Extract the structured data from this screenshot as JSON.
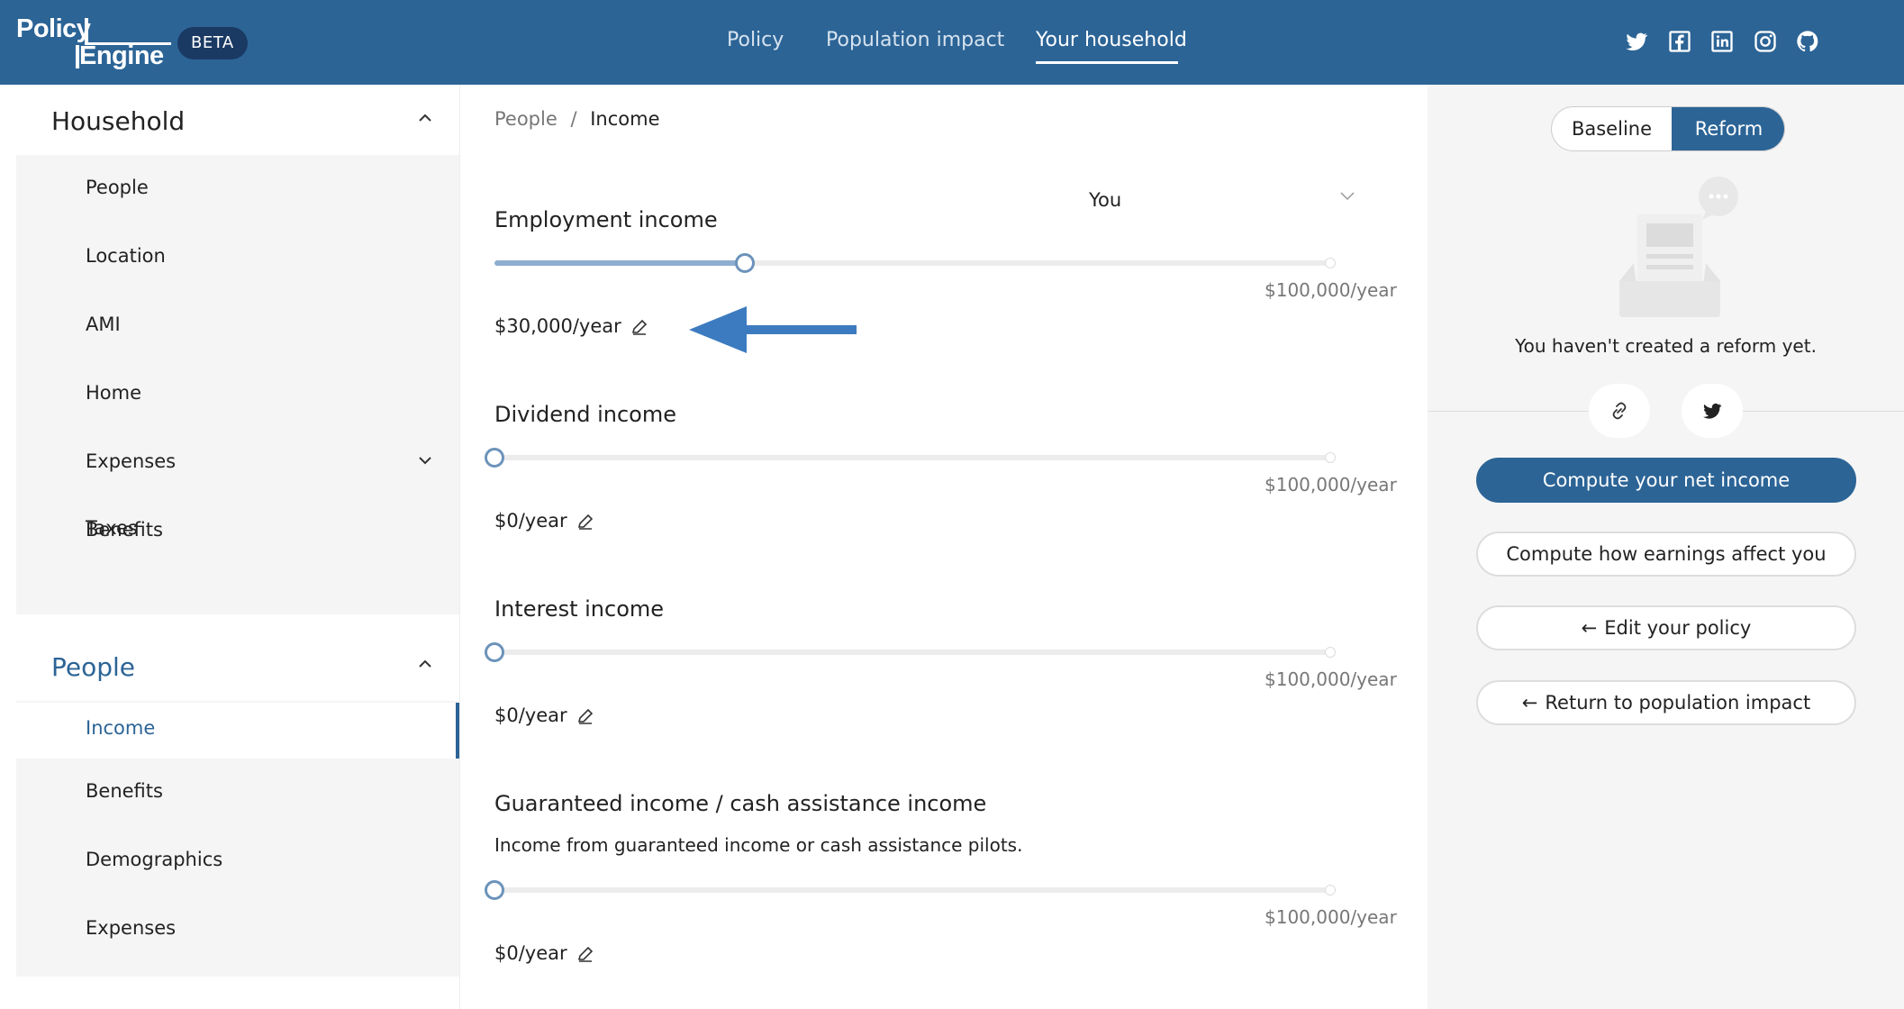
{
  "header": {
    "logo_line1": "Policy",
    "logo_line2": "Engine",
    "beta": "BETA",
    "nav": [
      "Policy",
      "Population impact",
      "Your household"
    ],
    "active_nav": "Your household",
    "social_icons": [
      "twitter-icon",
      "facebook-icon",
      "linkedin-icon",
      "instagram-icon",
      "github-icon"
    ],
    "colors": {
      "brand": "#2c6496",
      "beta_bg": "#1a3a63"
    }
  },
  "sidebar": {
    "household": {
      "title": "Household",
      "items": [
        "People",
        "Location",
        "AMI",
        "Home",
        "Expenses",
        "Benefits",
        "Taxes"
      ]
    },
    "people": {
      "title": "People",
      "items": [
        "Income",
        "Benefits",
        "Demographics",
        "Expenses"
      ],
      "active_item": "Income"
    }
  },
  "main": {
    "breadcrumb": {
      "parent": "People",
      "sep": "/",
      "current": "Income"
    },
    "member_select": "You",
    "fields": [
      {
        "title": "Employment income",
        "description": "",
        "max": "$100,000/year",
        "value": "$30,000/year",
        "fraction": 0.3
      },
      {
        "title": "Dividend income",
        "description": "",
        "max": "$100,000/year",
        "value": "$0/year",
        "fraction": 0
      },
      {
        "title": "Interest income",
        "description": "",
        "max": "$100,000/year",
        "value": "$0/year",
        "fraction": 0
      },
      {
        "title": "Guaranteed income / cash assistance income",
        "description": "Income from guaranteed income or cash assistance pilots.",
        "max": "$100,000/year",
        "value": "$0/year",
        "fraction": 0
      }
    ]
  },
  "right": {
    "toggle": {
      "baseline": "Baseline",
      "reform": "Reform",
      "selected": "Reform"
    },
    "empty_text": "You haven't created a reform yet.",
    "buttons": {
      "compute_net": "Compute your net income",
      "compute_earnings": "Compute how earnings affect you",
      "edit_policy": "Edit your policy",
      "return_impact": "Return to population impact"
    }
  }
}
